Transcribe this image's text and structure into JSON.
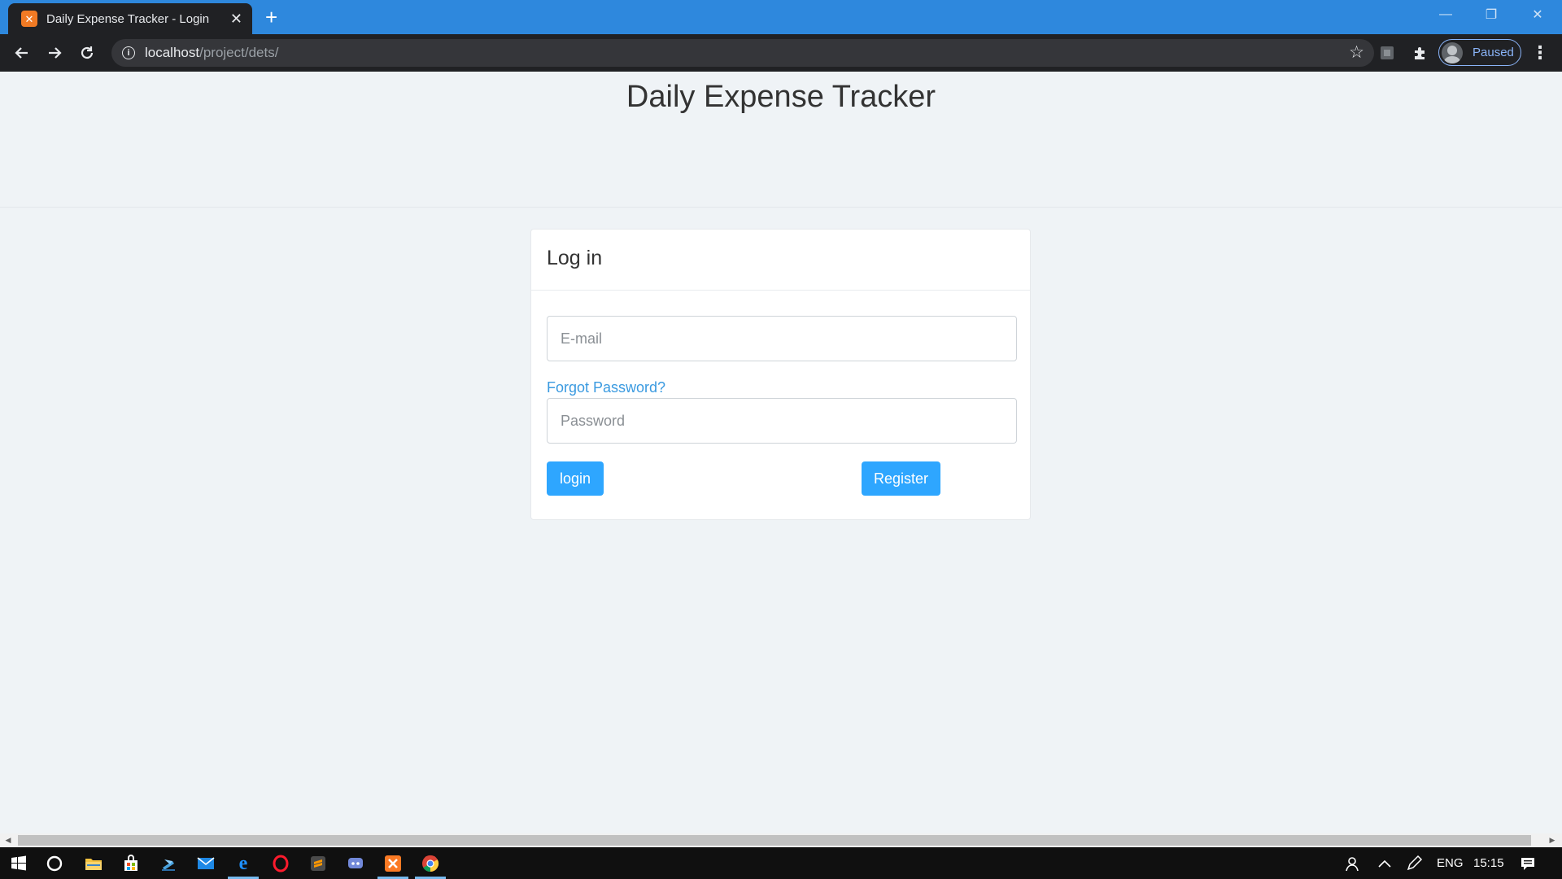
{
  "browser": {
    "tab_title": "Daily Expense Tracker - Login",
    "url_host": "localhost",
    "url_path": "/project/dets/",
    "profile_label": "Paused"
  },
  "page": {
    "title": "Daily Expense Tracker",
    "card_title": "Log in",
    "email_placeholder": "E-mail",
    "forgot_password": "Forgot Password?",
    "password_placeholder": "Password",
    "login_label": "login",
    "register_label": "Register"
  },
  "taskbar": {
    "language": "ENG",
    "time": "15:15"
  },
  "colors": {
    "tabbar": "#2e88dd",
    "toolbar": "#202124",
    "page_bg": "#eff3f6",
    "button": "#2ea6ff",
    "link": "#3a9ae0"
  },
  "icons": {
    "tab_favicon": "xampp-icon",
    "nav": [
      "back-arrow-icon",
      "forward-arrow-icon",
      "reload-icon"
    ],
    "toolbar": [
      "info-icon",
      "star-icon",
      "extension-icon",
      "puzzle-icon",
      "kebab-menu-icon"
    ],
    "taskbar": [
      "windows-start-icon",
      "cortana-icon",
      "file-explorer-icon",
      "store-icon",
      "winscp-icon",
      "mail-icon",
      "edge-icon",
      "opera-icon",
      "sublime-text-icon",
      "discord-icon",
      "xampp-icon",
      "chrome-icon"
    ],
    "tray": [
      "people-icon",
      "chevron-up-icon",
      "pen-icon",
      "notification-icon"
    ]
  }
}
